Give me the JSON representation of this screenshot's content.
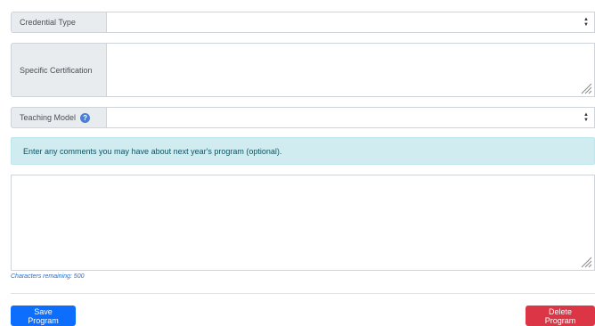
{
  "form": {
    "credential_type_label": "Credential Type",
    "specific_certification_label": "Specific Certification",
    "teaching_model_label": "Teaching Model",
    "teaching_model_help_icon": "question-circle-icon",
    "info_message": "Enter any comments you may have about next year's program (optional).",
    "characters_remaining": "Characters remaining: 500",
    "save_label": "Save Program",
    "delete_label": "Delete Program"
  },
  "colors": {
    "info_bg": "#d1ecf1",
    "save": "#0d6efd",
    "delete": "#dc3545"
  }
}
